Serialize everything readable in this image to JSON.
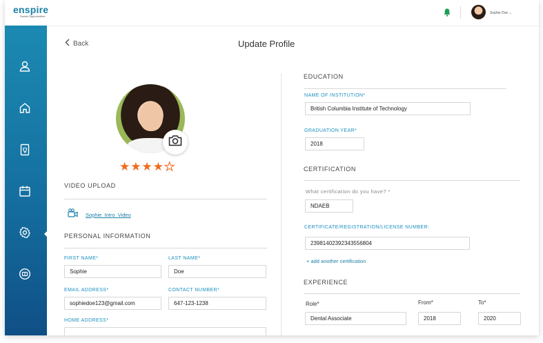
{
  "brand": {
    "logo_text": "enspire",
    "logo_sub": "Dental Opportunities"
  },
  "user": {
    "name": "Sophie Doe"
  },
  "page": {
    "back_label": "Back",
    "title": "Update Profile"
  },
  "rating": {
    "value": 4,
    "max": 5
  },
  "video": {
    "section_title": "VIDEO UPLOAD",
    "file_link": "Sophie_Intro_Video"
  },
  "personal": {
    "section_title": "PERSONAL INFORMATION",
    "first_name_label": "FIRST NAME*",
    "first_name": "Sophie",
    "last_name_label": "LAST NAME*",
    "last_name": "Doe",
    "email_label": "EMAIL ADDRESS*",
    "email": "sophiedoe123@gmail.com",
    "contact_label": "CONTACT NUMBER*",
    "contact": "647-123-1238",
    "address_label": "HOME ADDRESS*"
  },
  "education": {
    "section_title": "EDUCATION",
    "institution_label": "NAME OF INSTITUTION*",
    "institution": "British Columbia Institute of Technology",
    "year_label": "GRADUATION YEAR*",
    "year": "2018"
  },
  "certification": {
    "section_title": "CERTIFICATION",
    "question": "What certification do you have? *",
    "cert": "NDAEB",
    "number_label": "CERTIFICATE/REGISTRATION/LICENSE NUMBER:",
    "number": "23981402392343556804",
    "add_link": "+ add another certification"
  },
  "experience": {
    "section_title": "EXPERIENCE",
    "role_label": "Role*",
    "role": "Dental Associate",
    "from_label": "From*",
    "from": "2018",
    "to_label": "To*",
    "to": "2020"
  },
  "colors": {
    "accent": "#1a8fc0",
    "star": "#f06a1e",
    "sidebar_top": "#1b8ab2",
    "sidebar_bottom": "#0f4f86"
  },
  "icons": [
    "user-icon",
    "home-icon",
    "tooth-document-icon",
    "calendar-icon",
    "gear-icon",
    "support-icon",
    "bell-icon",
    "camera-icon",
    "video-file-icon",
    "chevron-left-icon",
    "chevron-down-icon"
  ]
}
